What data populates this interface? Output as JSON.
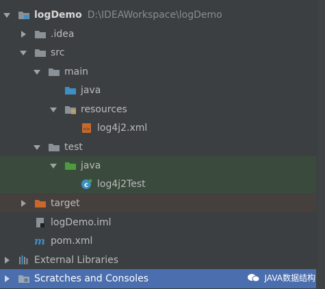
{
  "project": {
    "name": "logDemo",
    "path": "D:\\IDEAWorkspace\\logDemo"
  },
  "tree": {
    "idea": ".idea",
    "src": "src",
    "main": "main",
    "main_java": "java",
    "resources": "resources",
    "log4j2_xml": "log4j2.xml",
    "test": "test",
    "test_java": "java",
    "log4j2_test": "log4j2Test",
    "target": "target",
    "iml": "logDemo.iml",
    "pom": "pom.xml",
    "external_libraries": "External Libraries",
    "scratches": "Scratches and Consoles"
  },
  "watermark": "JAVA数据结构",
  "colors": {
    "background": "#3c3f41",
    "folder_gray": "#8a9197",
    "folder_blue": "#3f8fc4",
    "folder_green": "#4e9a3f",
    "folder_orange": "#c8682a",
    "selection_green": "#3a4a3d",
    "selection_brown": "#45403d",
    "selection_blue": "#4b6eaf"
  }
}
